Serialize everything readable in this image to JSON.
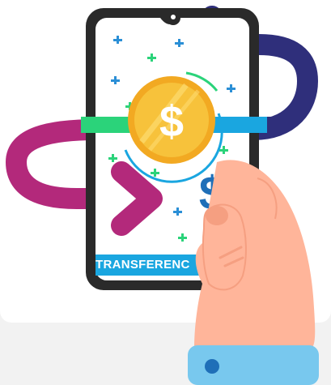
{
  "banner": {
    "label": "TRANSFERENC"
  },
  "colors": {
    "background": "#f2f2f2",
    "card": "#ffffff",
    "phone_frame": "#2a2a2a",
    "screen": "#ffffff",
    "banner": "#1aa6e0",
    "arrow_navy": "#2f2f7b",
    "arrow_magenta": "#b3297b",
    "stripe_green": "#2bd37a",
    "stripe_blue": "#1aa6e0",
    "coin_gold": "#f7c23b",
    "coin_rim": "#f2a922",
    "dollar_blue": "#1f6fb8",
    "skin": "#ffb59a",
    "cuff": "#78c8ee"
  },
  "icons": {
    "coin": "dollar-coin-icon",
    "small_dollar": "dollar-sign-icon",
    "arrow_left": "curved-arrow-left-icon",
    "arrow_right": "curved-arrow-right-icon",
    "sparkles": "sparkle-plus-icon"
  }
}
